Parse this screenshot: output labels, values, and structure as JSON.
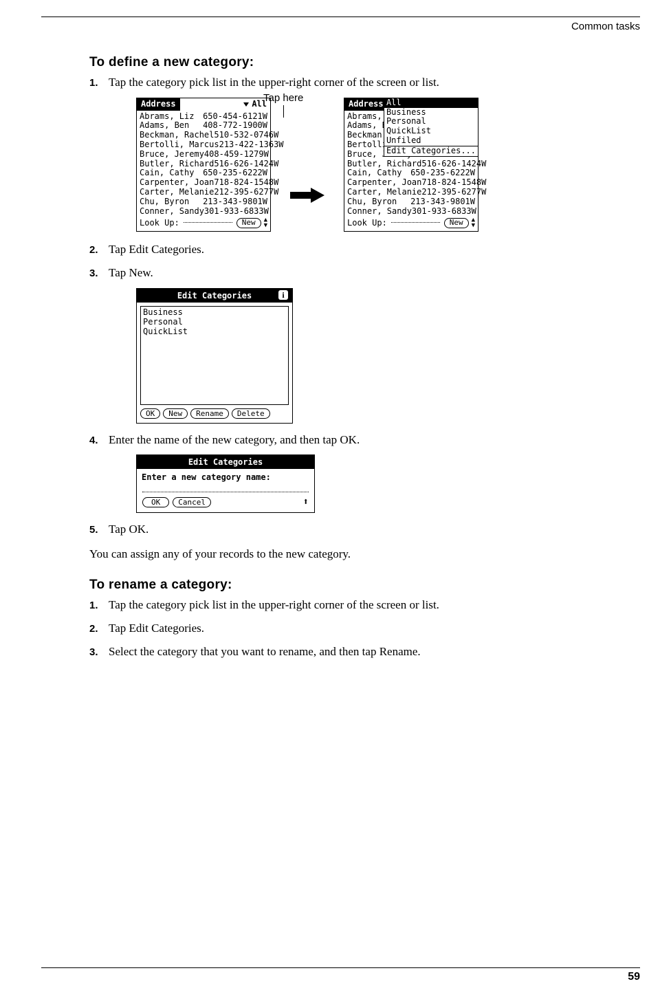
{
  "running_head": "Common tasks",
  "page_number": "59",
  "section1": {
    "title": "To define a new category:",
    "steps": [
      "Tap the category pick list in the upper-right corner of the screen or list.",
      "Tap Edit Categories.",
      "Tap New.",
      "Enter the name of the new category, and then tap OK.",
      "Tap OK."
    ],
    "closing": "You can assign any of your records to the new category."
  },
  "section2": {
    "title": "To rename a category:",
    "steps": [
      "Tap the category pick list in the upper-right corner of the screen or list.",
      "Tap Edit Categories.",
      "Select the category that you want to rename, and then tap Rename."
    ]
  },
  "callout": "Tap here",
  "address_screen": {
    "title": "Address",
    "category": "All",
    "contacts": [
      {
        "name": "Abrams, Liz",
        "phone": "650-454-6121W"
      },
      {
        "name": "Adams, Ben",
        "phone": "408-772-1900W"
      },
      {
        "name": "Beckman, Rachel",
        "phone": "510-532-0746W"
      },
      {
        "name": "Bertolli, Marcus",
        "phone": "213-422-1363W"
      },
      {
        "name": "Bruce, Jeremy",
        "phone": "408-459-1279W"
      },
      {
        "name": "Butler, Richard",
        "phone": "516-626-1424W"
      },
      {
        "name": "Cain, Cathy",
        "phone": "650-235-6222W"
      },
      {
        "name": "Carpenter, Joan",
        "phone": "718-824-1548W"
      },
      {
        "name": "Carter, Melanie",
        "phone": "212-395-6277W"
      },
      {
        "name": "Chu, Byron",
        "phone": "213-343-9801W"
      },
      {
        "name": "Conner, Sandy",
        "phone": "301-933-6833W"
      }
    ],
    "lookup_label": "Look Up:",
    "new_btn": "New"
  },
  "dropdown": {
    "highlighted": "All",
    "items": [
      "Business",
      "Personal",
      "QuickList",
      "Unfiled"
    ],
    "last": "Edit Categories..."
  },
  "address_screen2_visible_phones_start": 5,
  "edit_categories": {
    "title": "Edit Categories",
    "items": [
      "Business",
      "Personal",
      "QuickList"
    ],
    "buttons": {
      "ok": "OK",
      "new": "New",
      "rename": "Rename",
      "delete": "Delete"
    }
  },
  "new_category": {
    "title": "Edit Categories",
    "prompt": "Enter a new category name:",
    "buttons": {
      "ok": "OK",
      "cancel": "Cancel"
    }
  }
}
